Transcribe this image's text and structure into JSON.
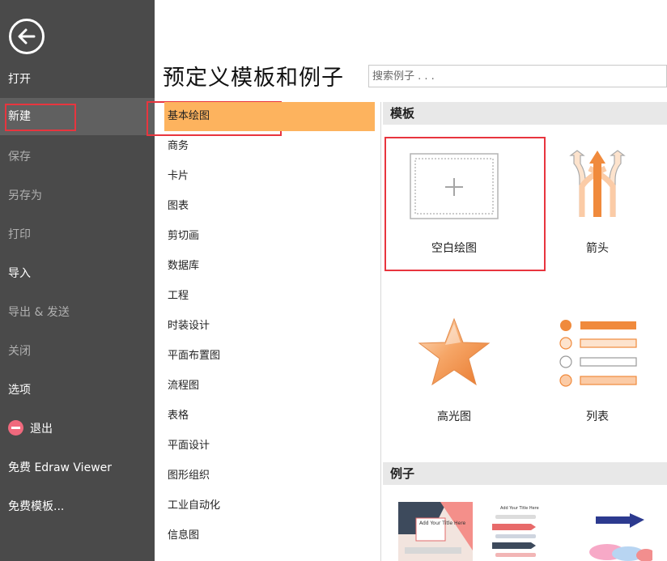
{
  "sidebar": {
    "items": [
      {
        "label": "打开",
        "state": "normal"
      },
      {
        "label": "新建",
        "state": "active"
      },
      {
        "label": "保存",
        "state": "disabled"
      },
      {
        "label": "另存为",
        "state": "disabled"
      },
      {
        "label": "打印",
        "state": "disabled"
      },
      {
        "label": "导入",
        "state": "normal"
      },
      {
        "label": "导出 & 发送",
        "state": "disabled"
      },
      {
        "label": "关闭",
        "state": "disabled"
      },
      {
        "label": "选项",
        "state": "normal"
      },
      {
        "label": "退出",
        "state": "normal"
      },
      {
        "label": "免费 Edraw Viewer",
        "state": "normal"
      },
      {
        "label": "免费模板...",
        "state": "normal"
      }
    ]
  },
  "header": {
    "title": "预定义模板和例子",
    "search_placeholder": "搜索例子 . . ."
  },
  "categories": [
    "基本绘图",
    "商务",
    "卡片",
    "图表",
    "剪切画",
    "数据库",
    "工程",
    "时装设计",
    "平面布置图",
    "流程图",
    "表格",
    "平面设计",
    "图形组织",
    "工业自动化",
    "信息图"
  ],
  "selected_category": "基本绘图",
  "templates": {
    "header": "模板",
    "items": [
      {
        "label": "空白绘图",
        "icon": "blank-drawing-icon"
      },
      {
        "label": "箭头",
        "icon": "arrows-icon"
      },
      {
        "label": "高光图",
        "icon": "highlight-star-icon"
      },
      {
        "label": "列表",
        "icon": "list-icon"
      }
    ]
  },
  "examples": {
    "header": "例子",
    "thumb1_text": "Add Your Title Here",
    "thumb2_text": "Add Your Title Here"
  },
  "colors": {
    "sidebar_bg": "#4a4a4a",
    "accent_orange": "#fdb35e",
    "highlight_red": "#e8353e",
    "orange_dark": "#f08a3c",
    "orange_light": "#fbcba6"
  }
}
